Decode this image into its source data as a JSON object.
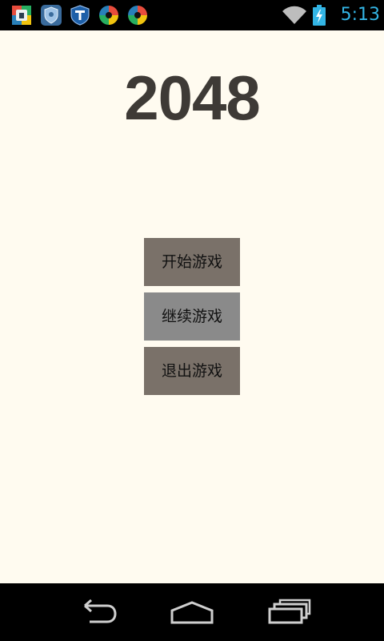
{
  "status_bar": {
    "time": "5:13",
    "time_color": "#33b5e5",
    "notification_icons": [
      "store-icon",
      "shield-icon",
      "security-t-icon",
      "pinwheel-icon",
      "pinwheel-icon"
    ],
    "wifi_icon": "wifi-icon",
    "battery_icon": "battery-charging-icon"
  },
  "main": {
    "title": "2048",
    "title_color": "#3e3a36",
    "background": "#fffbf0",
    "buttons": [
      {
        "label": "开始游戏",
        "color": "#7a7169"
      },
      {
        "label": "继续游戏",
        "color": "#8a8a8a"
      },
      {
        "label": "退出游戏",
        "color": "#7a7169"
      }
    ]
  },
  "nav_bar": {
    "icons": [
      "back-icon",
      "home-icon",
      "recent-apps-icon"
    ]
  }
}
